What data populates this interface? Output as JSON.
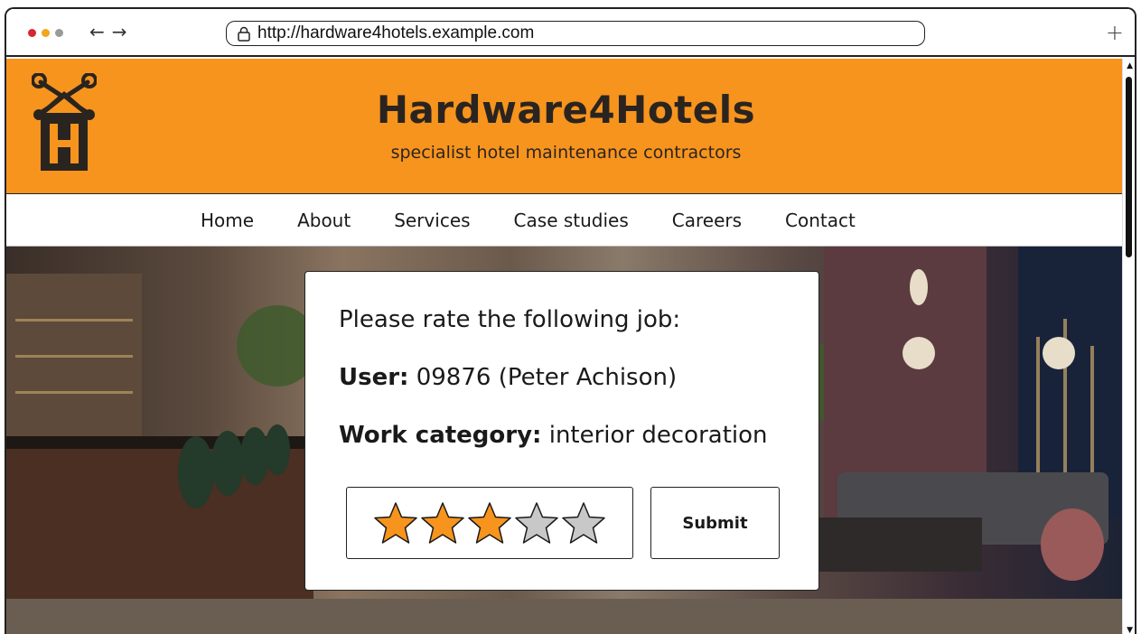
{
  "browser": {
    "url": "http://hardware4hotels.example.com",
    "new_tab_label": "+",
    "back_label": "←",
    "forward_label": "→"
  },
  "header": {
    "title": "Hardware4Hotels",
    "tagline": "specialist hotel maintenance contractors",
    "logo_icon": "house-wrench-logo-icon"
  },
  "nav": {
    "items": [
      "Home",
      "About",
      "Services",
      "Case studies",
      "Careers",
      "Contact"
    ]
  },
  "rating_card": {
    "prompt": "Please rate the following job:",
    "user_label": "User:",
    "user_value": "09876 (Peter Achison)",
    "category_label": "Work category:",
    "category_value": "interior decoration",
    "rating": 3,
    "max_rating": 5,
    "submit_label": "Submit"
  },
  "colors": {
    "brand_orange": "#f7941d",
    "star_filled": "#f7941d",
    "star_empty": "#c8c8c8",
    "text_dark": "#2a2420"
  }
}
